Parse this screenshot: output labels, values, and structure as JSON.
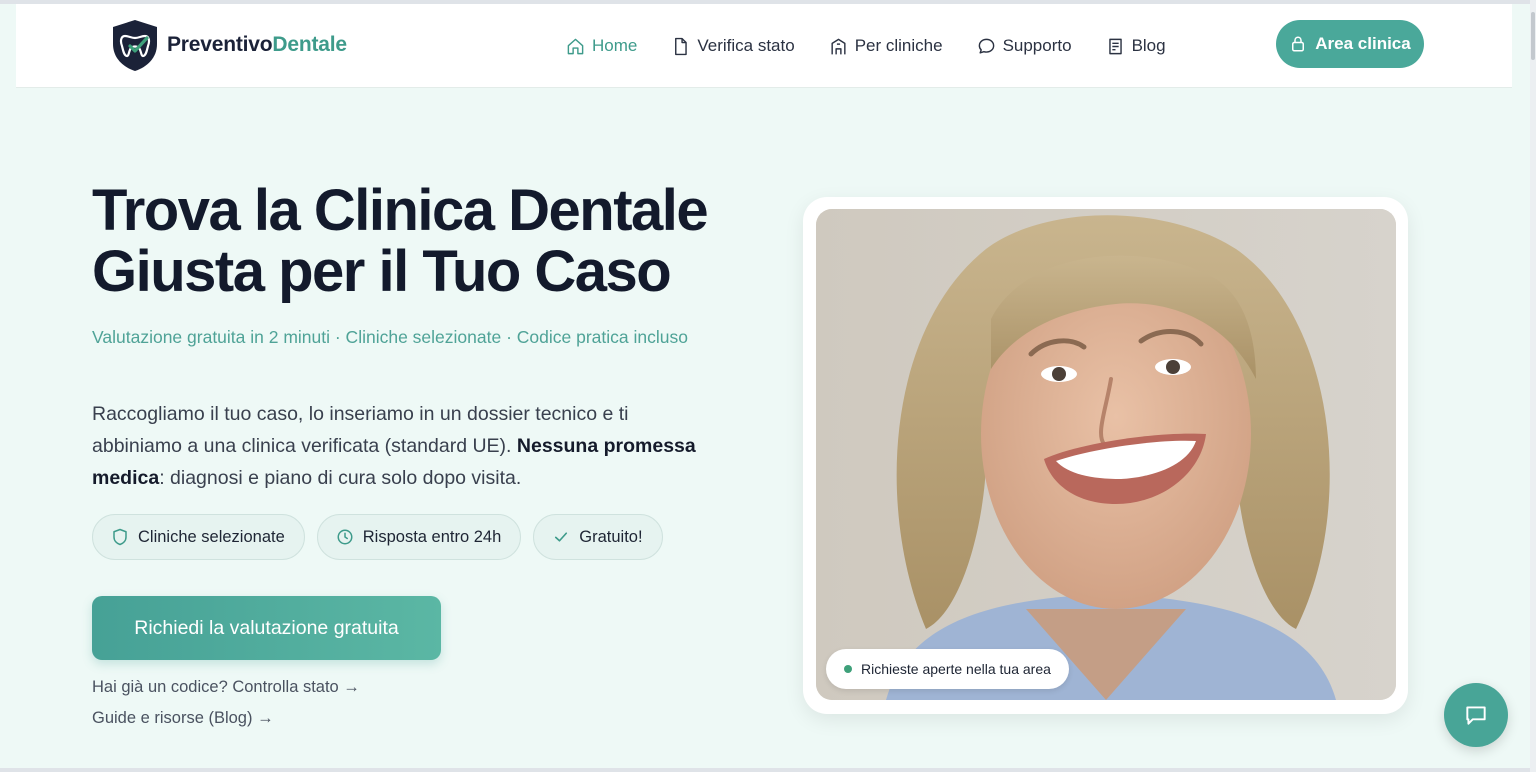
{
  "brand": {
    "name_part1": "Preventivo",
    "name_part2": "Dentale",
    "logo_icon": "tooth-shield-icon"
  },
  "nav": {
    "items": [
      {
        "label": "Home",
        "icon": "home-icon",
        "active": true
      },
      {
        "label": "Verifica stato",
        "icon": "document-icon",
        "active": false
      },
      {
        "label": "Per cliniche",
        "icon": "building-icon",
        "active": false
      },
      {
        "label": "Supporto",
        "icon": "chat-bubble-icon",
        "active": false
      },
      {
        "label": "Blog",
        "icon": "article-icon",
        "active": false
      }
    ],
    "cta_label": "Area clinica",
    "cta_icon": "lock-icon"
  },
  "hero": {
    "title_line1": "Trova la Clinica Dentale",
    "title_line2": "Giusta per il Tuo Caso",
    "tagline": "Valutazione gratuita in 2 minuti · Cliniche selezionate · Codice pratica incluso",
    "desc_part1": "Raccogliamo il tuo caso, lo inseriamo in un dossier tecnico e ti abbiniamo a una clinica verificata (standard UE). ",
    "desc_bold": "Nessuna promessa medica",
    "desc_part2": ": diagnosi e piano di cura solo dopo visita.",
    "badges": [
      {
        "label": "Cliniche selezionate",
        "icon": "shield-icon"
      },
      {
        "label": "Risposta entro 24h",
        "icon": "clock-icon"
      },
      {
        "label": "Gratuito!",
        "icon": "check-icon"
      }
    ],
    "cta_label": "Richiedi la valutazione gratuita",
    "link_status": "Hai già un codice? Controlla stato →",
    "link_blog": "Guide e risorse (Blog) →"
  },
  "photo": {
    "status_pill": "Richieste aperte nella tua area"
  },
  "chat": {
    "icon": "chat-bubble-icon"
  },
  "colors": {
    "accent": "#4aa89a",
    "heading": "#131a2c",
    "background": "#eef9f6"
  }
}
